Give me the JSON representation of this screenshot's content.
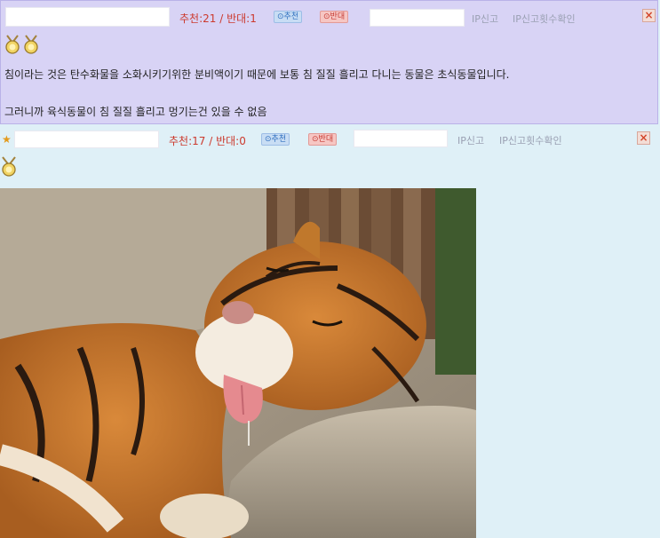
{
  "comment1": {
    "votes": "추천:21 / 반대:1",
    "up_label": "⊙추천",
    "down_label": "⊙반대",
    "ip_report": "IP신고",
    "ip_report_count": "IP신고횟수확인",
    "close_icon": "close-icon",
    "lines": [
      "침이라는 것은 탄수화물을 소화시키기위한 분비액이기 때문에 보통 침 질질 흘리고 다니는 동물은 초식동물입니다.",
      "그러니까 육식동물이 침 질질 흘리고 멍기는건 있을 수 없음"
    ]
  },
  "comment2": {
    "votes": "추천:17 / 반대:0",
    "up_label": "⊙추천",
    "down_label": "⊙반대",
    "ip_report": "IP신고",
    "ip_report_count": "IP신고횟수확인",
    "star_icon": "star-icon",
    "image_subject": "tiger-sleeping-with-tongue-out"
  },
  "colors": {
    "comment1_bg": "#d8d3f5",
    "comment2_bg": "#dff0f7",
    "votes": "#cc3a2e",
    "link": "#9aa0b3"
  }
}
